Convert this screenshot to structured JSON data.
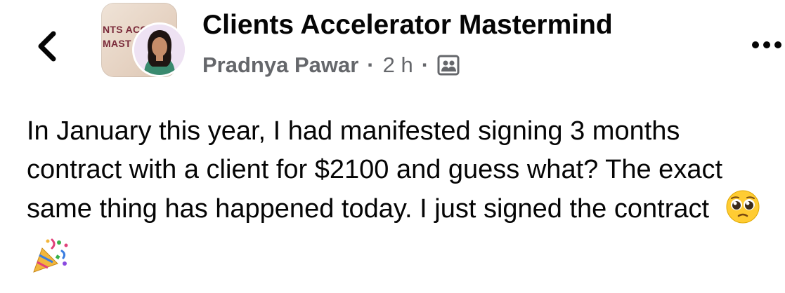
{
  "header": {
    "back_icon": "chevron-left-icon",
    "group_name": "Clients Accelerator Mastermind",
    "group_thumbnail_text_line1": "NTS ACC",
    "group_thumbnail_text_line2": "MAST",
    "author": "Pradnya Pawar",
    "separator": "·",
    "time": "2 h",
    "audience_icon": "group-members-icon",
    "more_icon": "more-options-icon"
  },
  "post": {
    "text": "In January this year, I had manifested signing 3 months contract with a client for $2100 and guess what? The exact same thing has happened today. I just signed the contract",
    "emojis": [
      "pleading-face-emoji",
      "party-popper-emoji"
    ]
  },
  "colors": {
    "text_primary": "#050505",
    "text_secondary": "#65676b",
    "background": "#ffffff"
  }
}
